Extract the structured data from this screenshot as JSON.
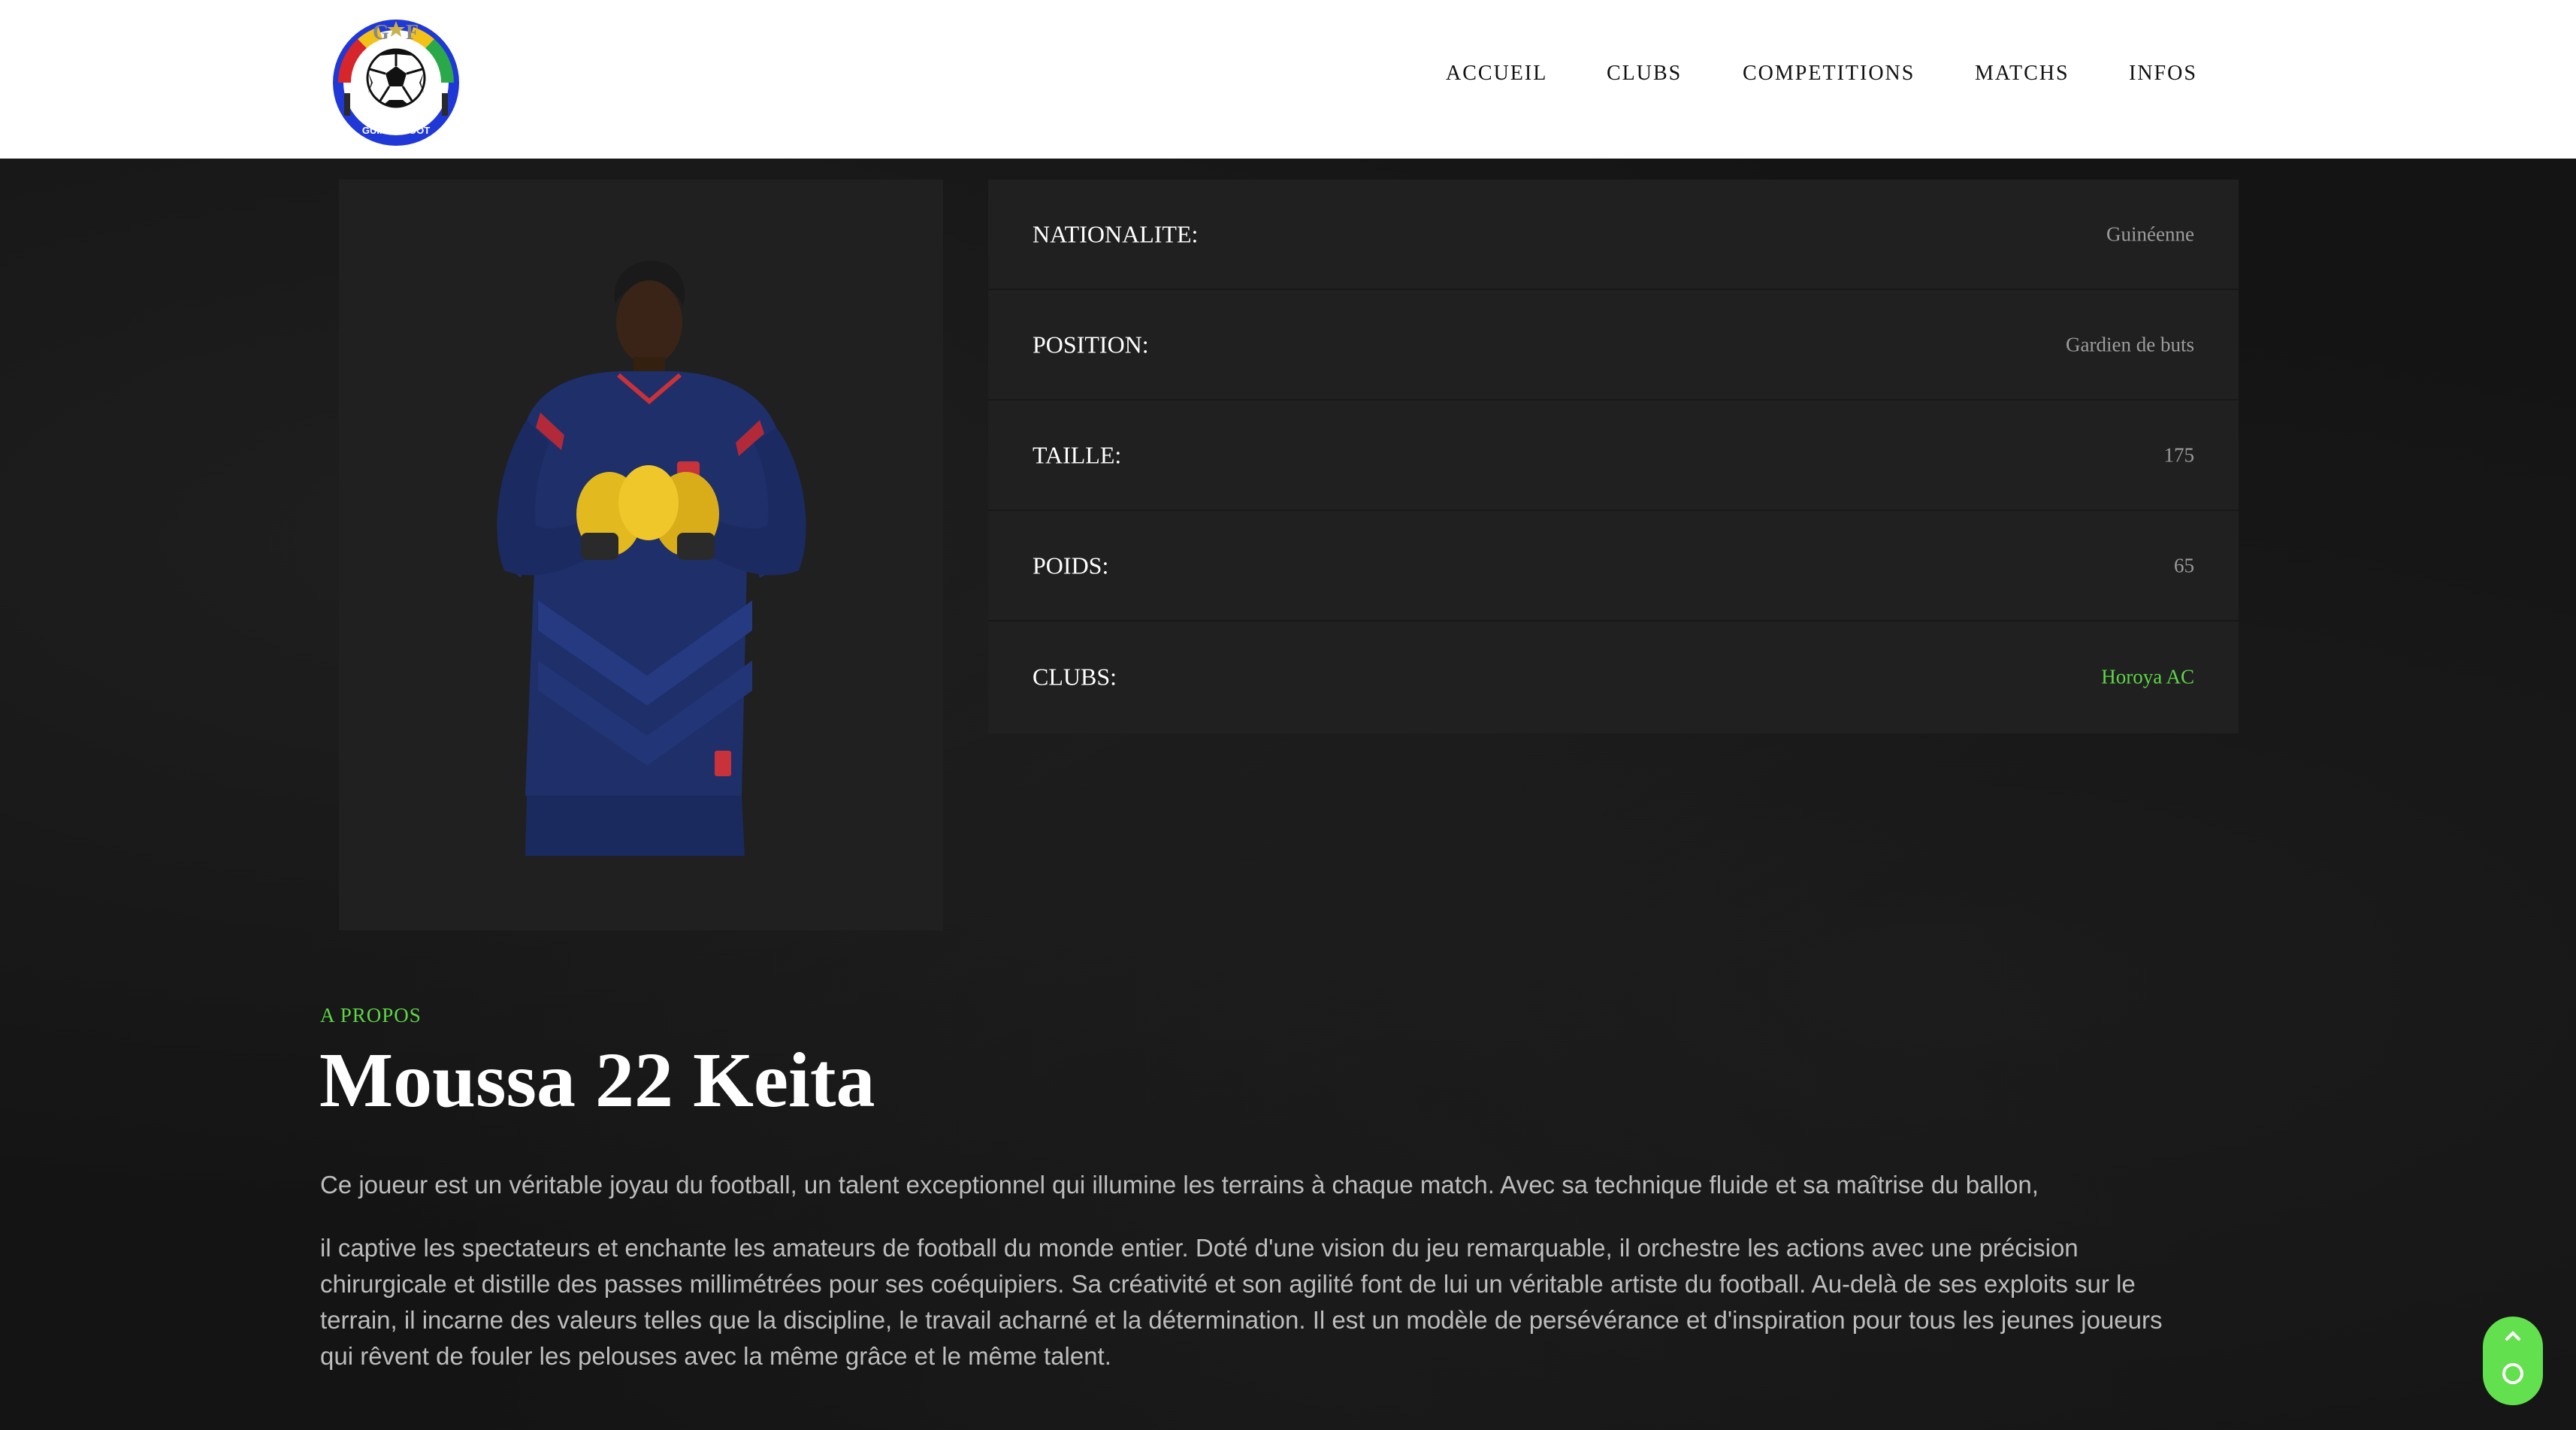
{
  "header": {
    "logo_text": "G F GUINEE-FOOT",
    "nav": [
      {
        "label": "ACCUEIL"
      },
      {
        "label": "CLUBS"
      },
      {
        "label": "COMPETITIONS"
      },
      {
        "label": "MATCHS"
      },
      {
        "label": "INFOS"
      }
    ]
  },
  "player": {
    "info": [
      {
        "label": "NATIONALITE:",
        "value": "Guinéenne"
      },
      {
        "label": "POSITION:",
        "value": "Gardien de buts"
      },
      {
        "label": "TAILLE:",
        "value": "175"
      },
      {
        "label": "POIDS:",
        "value": "65"
      },
      {
        "label": "CLUBS:",
        "value": "Horoya AC"
      }
    ],
    "about_kicker": "A PROPOS",
    "name": "Moussa 22 Keita",
    "bio_p1": "Ce joueur est un véritable joyau du football, un talent exceptionnel qui illumine les terrains à chaque match. Avec sa technique fluide et sa maîtrise du ballon,",
    "bio_p2": "il captive les spectateurs et enchante les amateurs de football du monde entier. Doté d'une vision du jeu remarquable, il orchestre les actions avec une précision chirurgicale et distille des passes millimétrées pour ses coéquipiers. Sa créativité et son agilité font de lui un véritable artiste du football. Au-delà de ses exploits sur le terrain, il incarne des valeurs telles que la discipline, le travail acharné et la détermination. Il est un modèle de persévérance et d'inspiration pour tous les jeunes joueurs qui rêvent de fouler les pelouses avec la même grâce et le même talent."
  },
  "colors": {
    "accent_green": "#5dd646",
    "header_bg": "#ffffff",
    "page_bg": "#151515",
    "card_bg": "#202020"
  },
  "icons": {
    "scroll_top": "chevron-up-icon"
  }
}
